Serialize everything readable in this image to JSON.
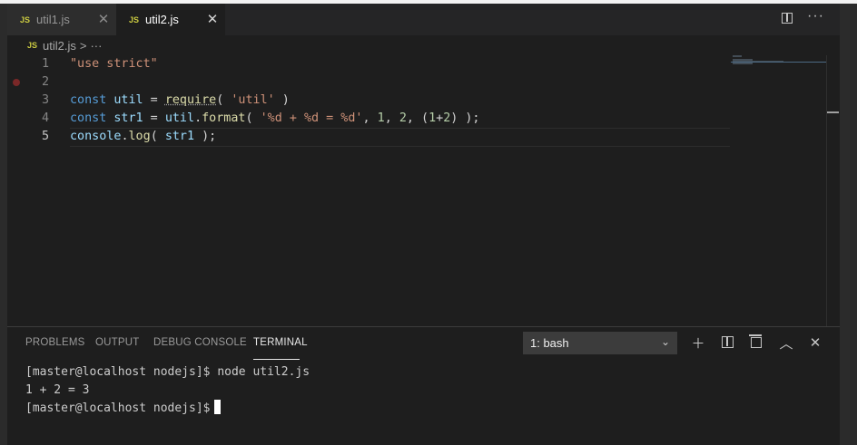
{
  "tabs": [
    {
      "icon": "JS",
      "label": "util1.js",
      "active": false
    },
    {
      "icon": "JS",
      "label": "util2.js",
      "active": true
    }
  ],
  "breadcrumb": {
    "icon": "JS",
    "file": "util2.js",
    "sep": ">",
    "more": "···"
  },
  "editor": {
    "line_numbers": [
      "1",
      "2",
      "3",
      "4",
      "5"
    ],
    "current_line": "5",
    "breakpoint_line": "2",
    "lines": {
      "l1": {
        "str": "\"use strict\""
      },
      "l3": {
        "kw": "const",
        "var": "util",
        "eq": " = ",
        "fn": "require",
        "open": "( ",
        "str": "'util'",
        "close": " )"
      },
      "l4": {
        "kw": "const",
        "var": "str1",
        "eq": " = ",
        "obj": "util",
        "dot": ".",
        "fn": "format",
        "open": "( ",
        "str": "'%d + %d = %d'",
        "sep1": ", ",
        "n1": "1",
        "sep2": ", ",
        "n2": "2",
        "sep3": ", (",
        "n3": "1",
        "plus": "+",
        "n4": "2",
        "close": ") );"
      },
      "l5": {
        "obj": "console",
        "dot": ".",
        "fn": "log",
        "open": "( ",
        "var": "str1",
        "close": " );"
      }
    }
  },
  "panel": {
    "tabs": [
      "PROBLEMS",
      "OUTPUT",
      "DEBUG CONSOLE",
      "TERMINAL"
    ],
    "active_tab": "TERMINAL",
    "terminal_select": "1: bash",
    "terminal_lines": [
      "[master@localhost nodejs]$ node util2.js",
      "1 + 2 = 3",
      "[master@localhost nodejs]$"
    ]
  },
  "colors": {
    "editor_bg": "#1e1e1e",
    "keyword": "#569cd6",
    "string": "#ce9178",
    "function": "#dcdcaa",
    "variable": "#9cdcfe",
    "number": "#b5cea8",
    "js_icon": "#cbcb41"
  }
}
